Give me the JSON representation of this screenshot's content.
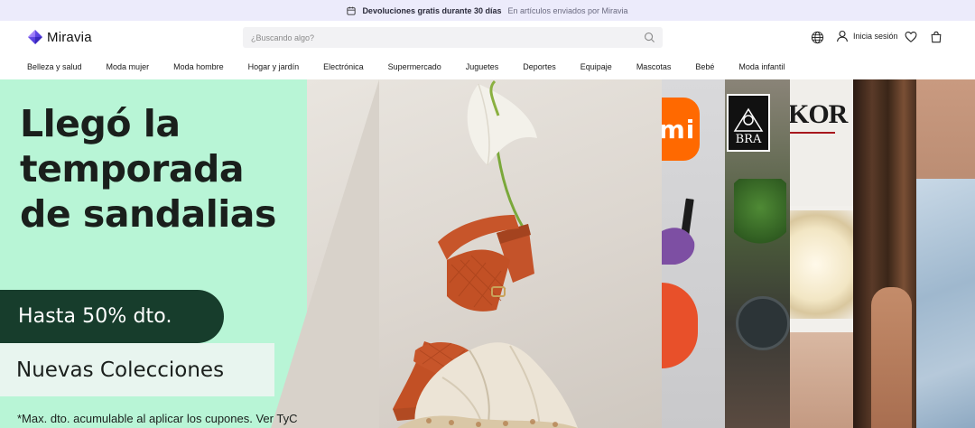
{
  "promo": {
    "icon": "calendar-icon",
    "bold_text": "Devoluciones gratis durante 30 días",
    "light_text": "En artículos enviados por Miravia"
  },
  "header": {
    "logo_text": "Miravia",
    "search_placeholder": "¿Buscando algo?",
    "login_label": "Inicia sesión",
    "icons": [
      "globe-icon",
      "user-icon",
      "heart-icon",
      "shopping-bag-icon",
      "search-icon"
    ]
  },
  "categories": [
    "Belleza y salud",
    "Moda mujer",
    "Moda hombre",
    "Hogar y jardín",
    "Electrónica",
    "Supermercado",
    "Juguetes",
    "Deportes",
    "Equipaje",
    "Mascotas",
    "Bebé",
    "Moda infantil"
  ],
  "banner": {
    "headline_line1": "Llegó la",
    "headline_line2": "temporada",
    "headline_line3": "de sandalias",
    "discount": "Hasta 50% dto.",
    "collections": "Nuevas Colecciones",
    "disclaimer": "*Max. dto. acumulable al aplicar los cupones. Ver TyC",
    "brands": [
      "mi",
      "BRA",
      "KOR"
    ]
  },
  "colors": {
    "promo_bg": "#ecebfb",
    "banner_mint": "#b8f5d6",
    "pill_dark_green": "#173d2c",
    "collections_bg": "#e8f5ef",
    "xiaomi_orange": "#ff6900",
    "sandal_orange": "#c7552a"
  }
}
